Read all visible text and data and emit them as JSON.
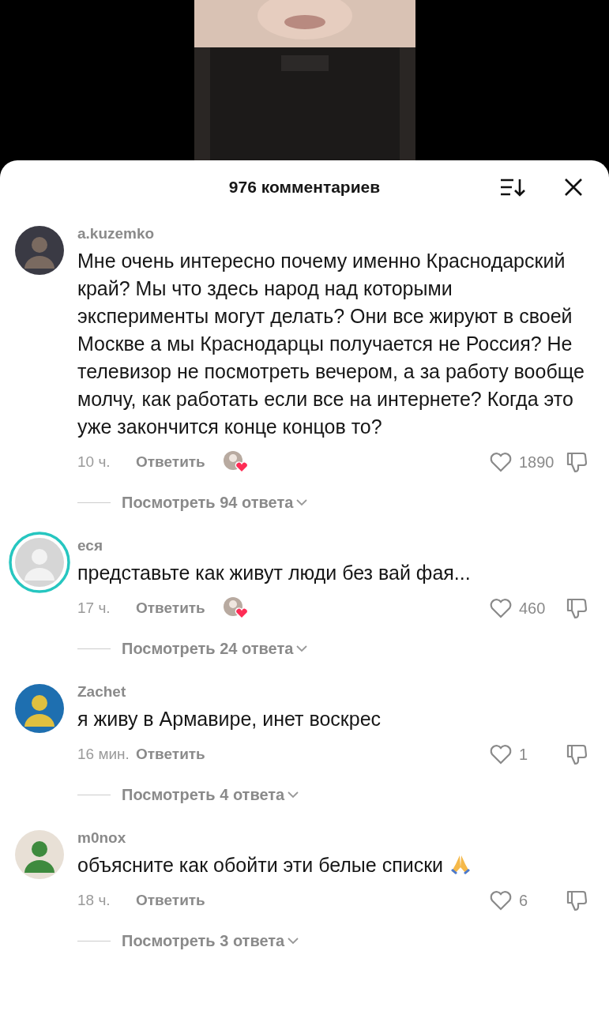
{
  "header": {
    "title": "976 комментариев"
  },
  "comments": [
    {
      "user": "a.kuzemko",
      "story_ring": false,
      "text": "Мне очень интересно почему именно Краснодарский край? Мы что здесь народ над которыми эксперименты могут делать? Они все жируют в своей Москве а мы Краснодарцы получается не Россия? Не телевизор не посмотреть вечером, а за работу вообще молчу, как работать если все на интернете? Когда это уже закончится конце концов то?",
      "emoji": false,
      "time": "10 ч.",
      "reply": "Ответить",
      "creator_liked": true,
      "likes": "1890",
      "replies": "Посмотреть 94 ответа"
    },
    {
      "user": "еся",
      "story_ring": true,
      "text": "представьте как живут люди без вай фая...",
      "emoji": false,
      "time": "17 ч.",
      "reply": "Ответить",
      "creator_liked": true,
      "likes": "460",
      "replies": "Посмотреть 24 ответа"
    },
    {
      "user": "Zachet",
      "story_ring": false,
      "text": "я живу в Армавире, инет воскрес",
      "emoji": false,
      "time": "16 мин.",
      "reply": "Ответить",
      "creator_liked": false,
      "likes": "1",
      "replies": "Посмотреть 4 ответа"
    },
    {
      "user": "m0nox",
      "story_ring": false,
      "text": "объясните как обойти эти белые списки",
      "emoji": true,
      "time": "18 ч.",
      "reply": "Ответить",
      "creator_liked": false,
      "likes": "6",
      "replies": "Посмотреть 3 ответа"
    }
  ]
}
